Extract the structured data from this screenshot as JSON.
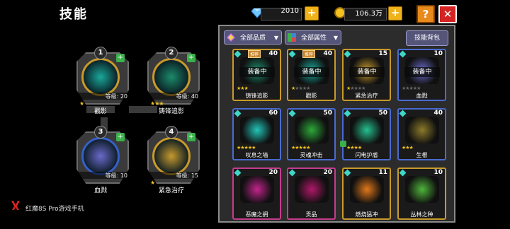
{
  "header": {
    "title": "技能",
    "gems": "2010",
    "coins": "106.3万",
    "help_label": "?",
    "close_label": "✕"
  },
  "slots": [
    {
      "num": "1",
      "level": "等级: 20",
      "name": "戳影",
      "stars": "★",
      "ring": "gold",
      "art": "#1aa89a"
    },
    {
      "num": "2",
      "level": "等级: 40",
      "name": "铸锋追影",
      "stars": "★★★",
      "ring": "gold",
      "art": "#1c8a6a"
    },
    {
      "num": "3",
      "level": "等级: 10",
      "name": "血戮",
      "stars": "",
      "ring": "blue",
      "art": "#6a6acb"
    },
    {
      "num": "4",
      "level": "等级: 15",
      "name": "紧急治疗",
      "stars": "★",
      "ring": "gold",
      "art": "#c69a2e"
    }
  ],
  "panel": {
    "quality_filter": "全部品质",
    "attribute_filter": "全部属性",
    "bag_button": "技能背包",
    "cards": [
      {
        "name": "铸锋追影",
        "count": "40",
        "rec": "推荐",
        "equipped": "装备中",
        "stars": "★★★",
        "dim": "",
        "frame": "gold",
        "art": "#1c8a6a"
      },
      {
        "name": "戳影",
        "count": "40",
        "rec": "推荐",
        "equipped": "装备中",
        "stars": "★",
        "dim": "★★★★",
        "frame": "gold",
        "art": "#1aa89a"
      },
      {
        "name": "紧急治疗",
        "count": "15",
        "rec": "",
        "equipped": "装备中",
        "stars": "★",
        "dim": "★★★★",
        "frame": "gold",
        "art": "#c69a2e"
      },
      {
        "name": "血戮",
        "count": "10",
        "rec": "",
        "equipped": "装备中",
        "stars": "",
        "dim": "★★★★★",
        "frame": "blue",
        "art": "#6a6acb"
      },
      {
        "name": "叹息之墙",
        "count": "60",
        "rec": "",
        "equipped": "",
        "stars": "★★★★★",
        "dim": "",
        "frame": "blue",
        "art": "#22c4b8"
      },
      {
        "name": "灵魂冲击",
        "count": "50",
        "rec": "",
        "equipped": "",
        "stars": "★★★★★",
        "dim": "",
        "frame": "blue",
        "art": "#2da83a"
      },
      {
        "name": "闪电护盾",
        "count": "50",
        "rec": "",
        "equipped": "",
        "stars": "★★★★",
        "dim": "",
        "frame": "blue",
        "art": "#25c08e"
      },
      {
        "name": "生根",
        "count": "40",
        "rec": "",
        "equipped": "",
        "stars": "★★★",
        "dim": "",
        "frame": "blue",
        "art": "#8c7a2a"
      },
      {
        "name": "恶魔之拥",
        "count": "20",
        "rec": "",
        "equipped": "",
        "stars": "",
        "dim": "",
        "frame": "pink",
        "art": "#c2248c"
      },
      {
        "name": "贡品",
        "count": "20",
        "rec": "",
        "equipped": "",
        "stars": "",
        "dim": "",
        "frame": "pink",
        "art": "#b01868"
      },
      {
        "name": "燃烧猛冲",
        "count": "11",
        "rec": "",
        "equipped": "",
        "stars": "",
        "dim": "",
        "frame": "gold",
        "art": "#e0781a"
      },
      {
        "name": "丛林之种",
        "count": "10",
        "rec": "",
        "equipped": "",
        "stars": "",
        "dim": "",
        "frame": "gold",
        "art": "#4fb53a"
      }
    ]
  },
  "footer": {
    "brand": "红魔8S Pro游戏手机"
  }
}
